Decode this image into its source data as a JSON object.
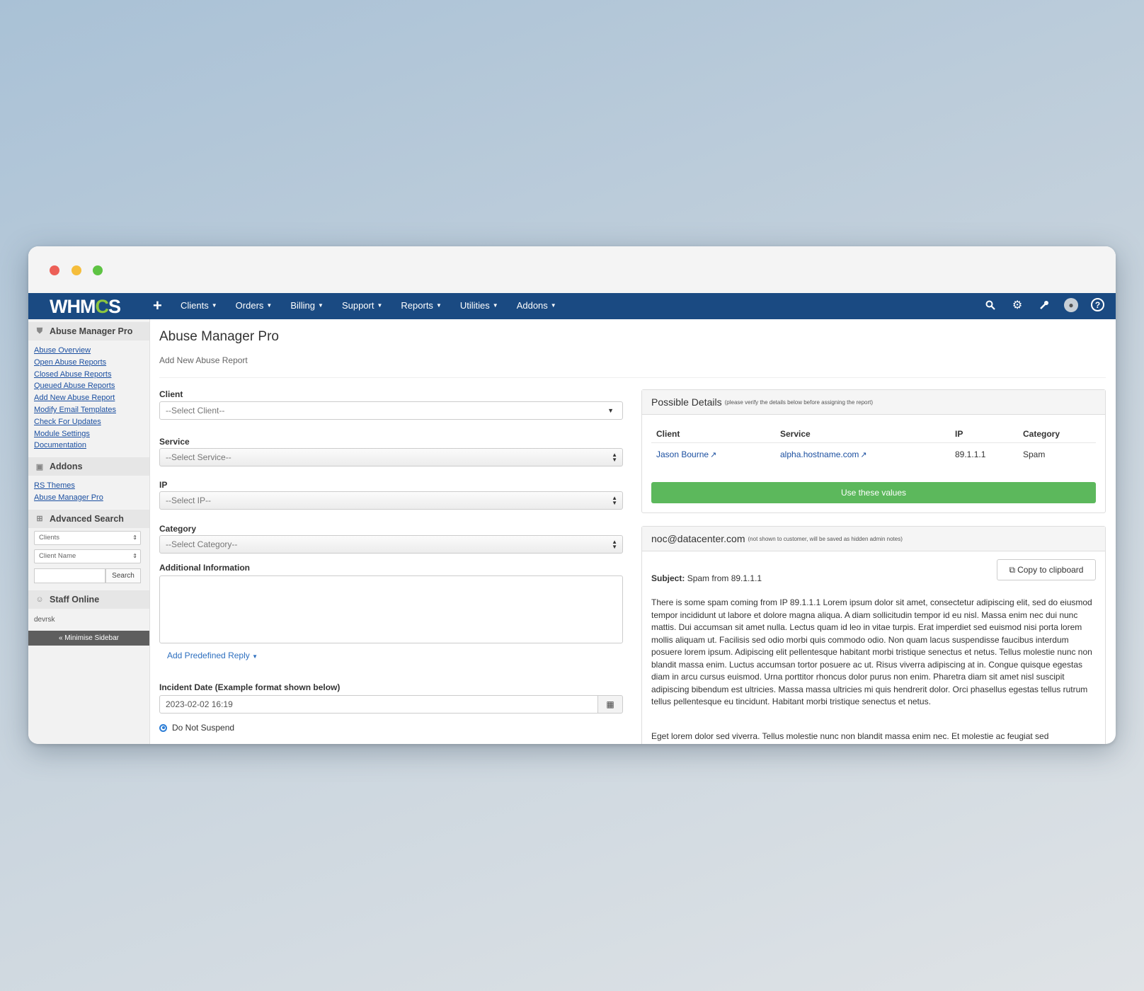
{
  "navbar": {
    "logo": "WHMCS",
    "plus": "+",
    "items": [
      "Clients",
      "Orders",
      "Billing",
      "Support",
      "Reports",
      "Utilities",
      "Addons"
    ]
  },
  "sidebar": {
    "section1": {
      "title": "Abuse Manager Pro",
      "links": [
        "Abuse Overview",
        "Open Abuse Reports",
        "Closed Abuse Reports",
        "Queued Abuse Reports",
        "Add New Abuse Report",
        "Modify Email Templates",
        "Check For Updates",
        "Module Settings",
        "Documentation"
      ]
    },
    "section2": {
      "title": "Addons",
      "links": [
        "RS Themes",
        "Abuse Manager Pro"
      ]
    },
    "section3": {
      "title": "Advanced Search",
      "select1": "Clients",
      "select2": "Client Name",
      "search_button": "Search"
    },
    "section4": {
      "title": "Staff Online",
      "staff": "devrsk"
    },
    "minimise": "« Minimise Sidebar"
  },
  "main": {
    "title": "Abuse Manager Pro",
    "subtitle": "Add New Abuse Report",
    "client_label": "Client",
    "client_placeholder": "--Select Client--",
    "service_label": "Service",
    "service_placeholder": "--Select Service--",
    "ip_label": "IP",
    "ip_placeholder": "--Select IP--",
    "category_label": "Category",
    "category_placeholder": "--Select Category--",
    "additional_label": "Additional Information",
    "predefined_reply": "Add Predefined Reply",
    "incident_label": "Incident Date (Example format shown below)",
    "incident_value": "2023-02-02 16:19",
    "radio_label": "Do Not Suspend"
  },
  "possible": {
    "title": "Possible Details",
    "note": "(please verify the details below before assigning the report)",
    "headers": [
      "Client",
      "Service",
      "IP",
      "Category"
    ],
    "row": {
      "client": "Jason Bourne",
      "service": "alpha.hostname.com",
      "ip": "89.1.1.1",
      "category": "Spam"
    },
    "button": "Use these values"
  },
  "email": {
    "title": "noc@datacenter.com",
    "note": "(not shown to customer, will be saved as hidden admin notes)",
    "copy_button": "Copy to clipboard",
    "subject_label": "Subject:",
    "subject_value": "Spam from 89.1.1.1",
    "body": "There is some spam coming from IP 89.1.1.1 Lorem ipsum dolor sit amet, consectetur adipiscing elit, sed do eiusmod tempor incididunt ut labore et dolore magna aliqua. A diam sollicitudin tempor id eu nisl. Massa enim nec dui nunc mattis. Dui accumsan sit amet nulla. Lectus quam id leo in vitae turpis. Erat imperdiet sed euismod nisi porta lorem mollis aliquam ut. Facilisis sed odio morbi quis commodo odio. Non quam lacus suspendisse faucibus interdum posuere lorem ipsum. Adipiscing elit pellentesque habitant morbi tristique senectus et netus. Tellus molestie nunc non blandit massa enim. Luctus accumsan tortor posuere ac ut. Risus viverra adipiscing at in. Congue quisque egestas diam in arcu cursus euismod. Urna porttitor rhoncus dolor purus non enim. Pharetra diam sit amet nisl suscipit adipiscing bibendum est ultricies. Massa massa ultricies mi quis hendrerit dolor. Orci phasellus egestas tellus rutrum tellus pellentesque eu tincidunt. Habitant morbi tristique senectus et netus.",
    "body2": "Eget lorem dolor sed viverra. Tellus molestie nunc non blandit massa enim nec. Et molestie ac feugiat sed"
  }
}
